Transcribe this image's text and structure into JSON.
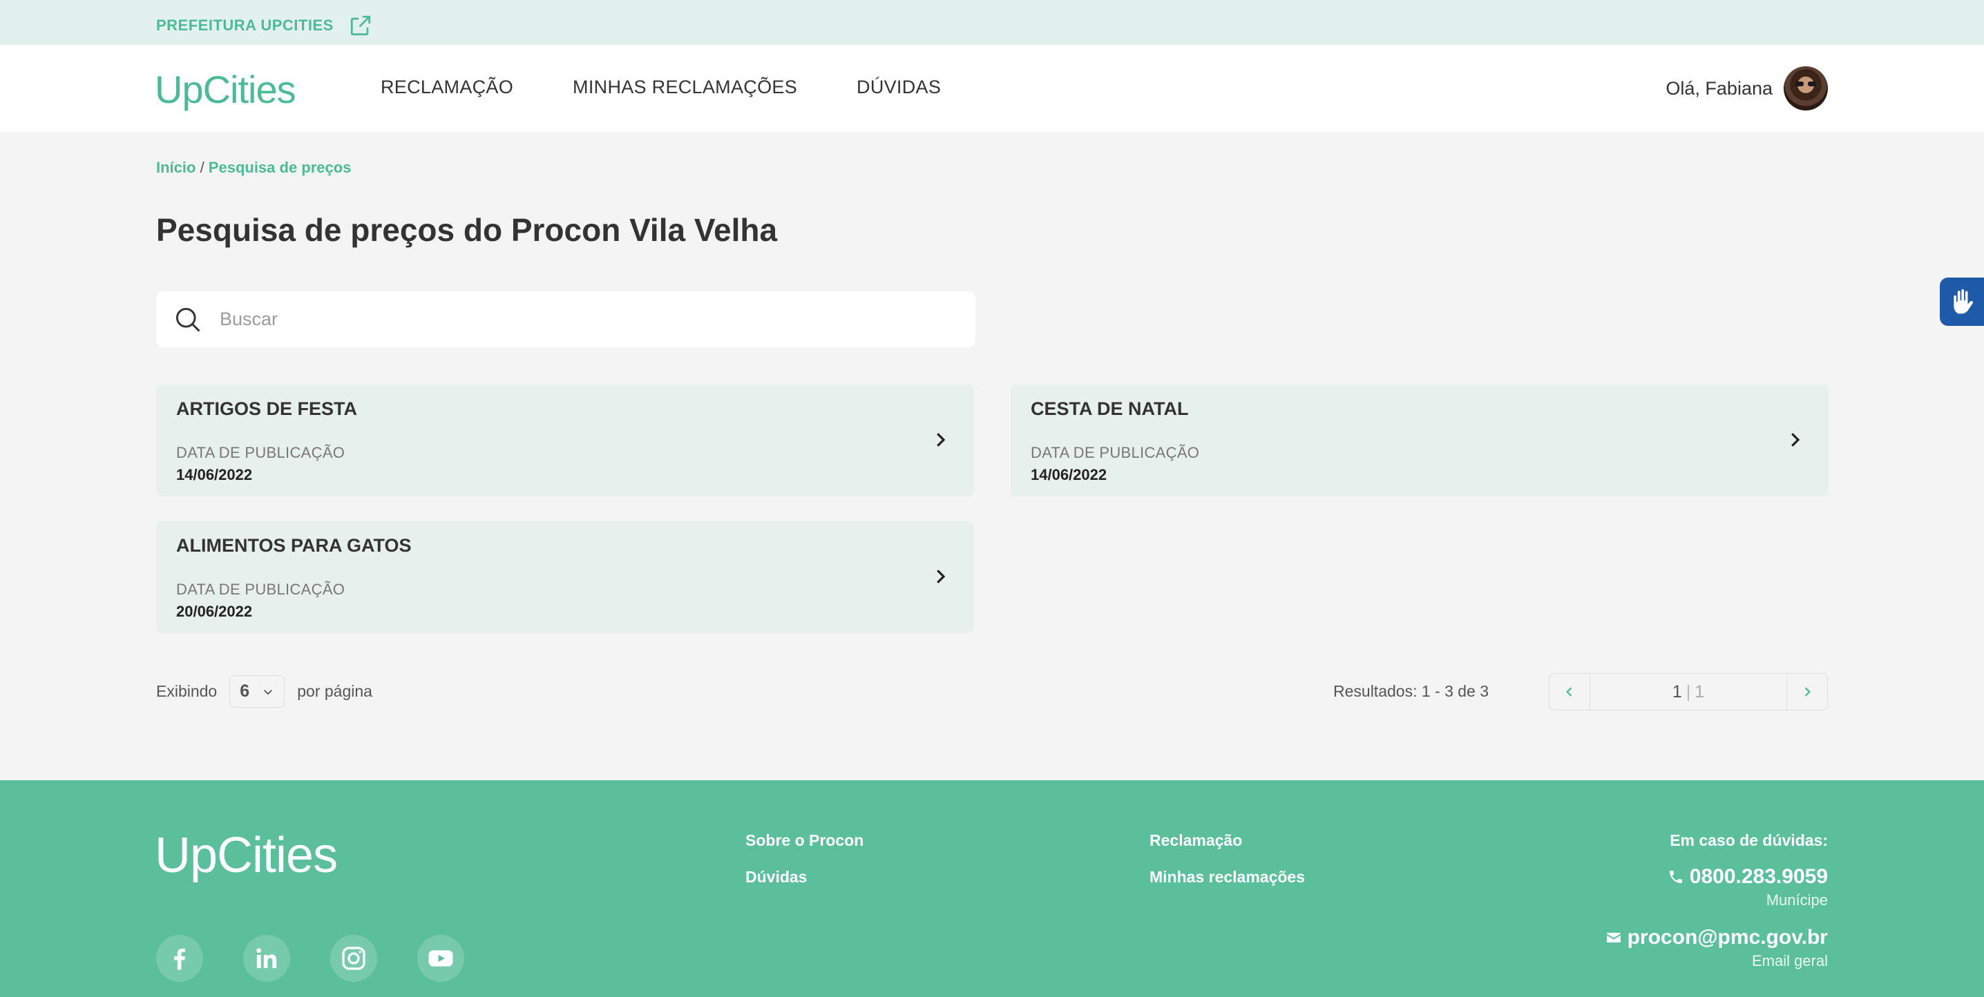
{
  "topbar": {
    "city_link": "PREFEITURA UPCITIES",
    "icon": "external-link-icon"
  },
  "nav": {
    "logo": "UpCities",
    "menu": [
      "RECLAMAÇÃO",
      "MINHAS RECLAMAÇÕES",
      "DÚVIDAS"
    ],
    "greeting": "Olá, Fabiana"
  },
  "breadcrumb": {
    "home": "Início",
    "separator": " / ",
    "current": "Pesquisa de preços"
  },
  "page_title": "Pesquisa de preços do Procon Vila Velha",
  "search": {
    "placeholder": "Buscar",
    "value": ""
  },
  "cards": [
    {
      "name": "ARTIGOS DE FESTA",
      "label": "DATA DE PUBLICAÇÃO",
      "date": "14/06/2022"
    },
    {
      "name": "CESTA DE NATAL",
      "label": "DATA DE PUBLICAÇÃO",
      "date": "14/06/2022"
    },
    {
      "name": "ALIMENTOS PARA GATOS",
      "label": "DATA DE PUBLICAÇÃO",
      "date": "20/06/2022"
    }
  ],
  "pagination": {
    "showing_label": "Exibindo",
    "per_page_value": "6",
    "per_page_label": "por página",
    "results": "Resultados: 1 - 3 de 3",
    "current_page": "1",
    "separator": "|",
    "total_pages": "1"
  },
  "footer": {
    "logo": "UpCities",
    "links_col1": [
      "Sobre o Procon",
      "Dúvidas"
    ],
    "links_col2": [
      "Reclamação",
      "Minhas reclamações"
    ],
    "contact_title": "Em caso de dúvidas:",
    "phone": "0800.283.9059",
    "phone_sub": "Munícipe",
    "email": "procon@pmc.gov.br",
    "email_sub": "Email geral",
    "socials": [
      "facebook-icon",
      "linkedin-icon",
      "instagram-icon",
      "youtube-icon"
    ]
  },
  "colors": {
    "accent": "#4bbb96",
    "footer_bg": "#5bbf9b",
    "card_bg": "#e8f0ee",
    "topbar_bg": "#e3f1ee"
  }
}
